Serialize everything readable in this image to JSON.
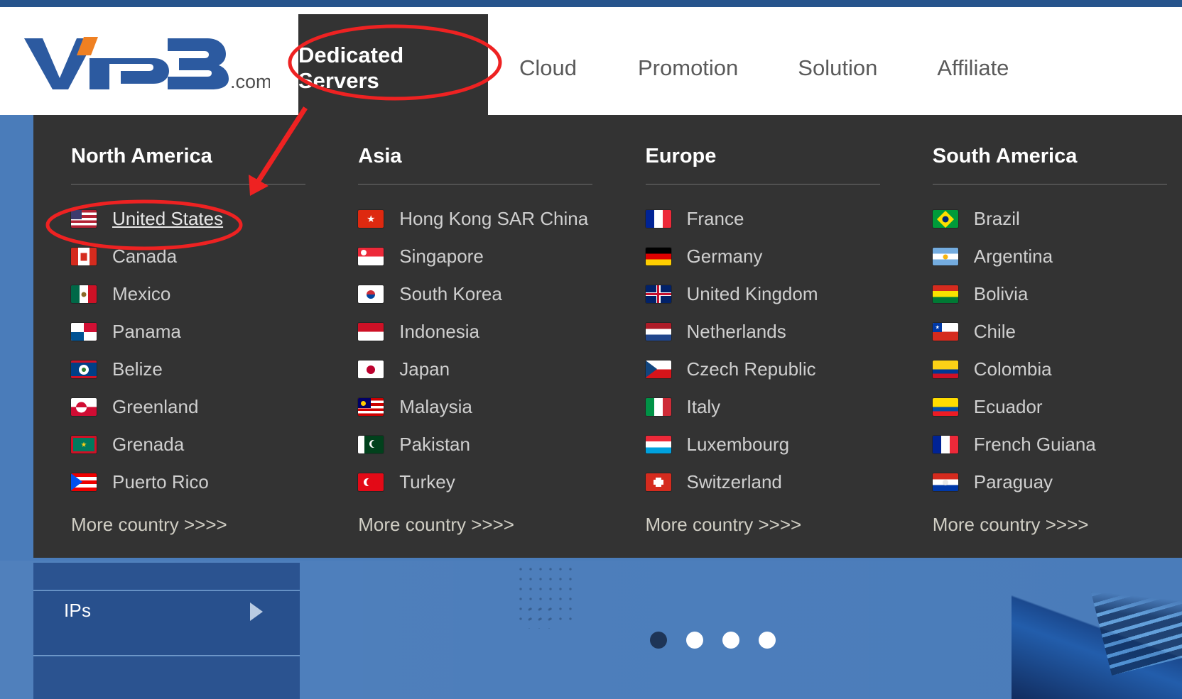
{
  "brand": {
    "logo_text": "VPB",
    "logo_suffix": ".com",
    "accent_blue": "#2c5aa0",
    "accent_orange": "#ef8022"
  },
  "nav": {
    "items": [
      {
        "label": "Dedicated Servers",
        "active": true
      },
      {
        "label": "Cloud",
        "active": false
      },
      {
        "label": "Promotion",
        "active": false
      },
      {
        "label": "Solution",
        "active": false
      },
      {
        "label": "Affiliate",
        "active": false
      }
    ]
  },
  "mega_menu": {
    "more_link_label": "More country >>>>",
    "columns": [
      {
        "title": "North America",
        "countries": [
          {
            "name": "United States",
            "flag": "us",
            "highlighted": true
          },
          {
            "name": "Canada",
            "flag": "ca",
            "highlighted": false
          },
          {
            "name": "Mexico",
            "flag": "mx",
            "highlighted": false
          },
          {
            "name": "Panama",
            "flag": "pa",
            "highlighted": false
          },
          {
            "name": "Belize",
            "flag": "bz",
            "highlighted": false
          },
          {
            "name": "Greenland",
            "flag": "gl",
            "highlighted": false
          },
          {
            "name": "Grenada",
            "flag": "gd",
            "highlighted": false
          },
          {
            "name": "Puerto Rico",
            "flag": "pr",
            "highlighted": false
          }
        ]
      },
      {
        "title": "Asia",
        "countries": [
          {
            "name": "Hong Kong SAR China",
            "flag": "hk",
            "highlighted": false
          },
          {
            "name": "Singapore",
            "flag": "sg",
            "highlighted": false
          },
          {
            "name": "South Korea",
            "flag": "kr",
            "highlighted": false
          },
          {
            "name": "Indonesia",
            "flag": "id",
            "highlighted": false
          },
          {
            "name": "Japan",
            "flag": "jp",
            "highlighted": false
          },
          {
            "name": "Malaysia",
            "flag": "my",
            "highlighted": false
          },
          {
            "name": "Pakistan",
            "flag": "pk",
            "highlighted": false
          },
          {
            "name": "Turkey",
            "flag": "tr",
            "highlighted": false
          }
        ]
      },
      {
        "title": "Europe",
        "countries": [
          {
            "name": "France",
            "flag": "fr",
            "highlighted": false
          },
          {
            "name": "Germany",
            "flag": "de",
            "highlighted": false
          },
          {
            "name": "United Kingdom",
            "flag": "gb",
            "highlighted": false
          },
          {
            "name": "Netherlands",
            "flag": "nl",
            "highlighted": false
          },
          {
            "name": "Czech Republic",
            "flag": "cz",
            "highlighted": false
          },
          {
            "name": "Italy",
            "flag": "it",
            "highlighted": false
          },
          {
            "name": "Luxembourg",
            "flag": "lu",
            "highlighted": false
          },
          {
            "name": "Switzerland",
            "flag": "ch",
            "highlighted": false
          }
        ]
      },
      {
        "title": "South America",
        "countries": [
          {
            "name": "Brazil",
            "flag": "br",
            "highlighted": false
          },
          {
            "name": "Argentina",
            "flag": "ar",
            "highlighted": false
          },
          {
            "name": "Bolivia",
            "flag": "bo",
            "highlighted": false
          },
          {
            "name": "Chile",
            "flag": "cl",
            "highlighted": false
          },
          {
            "name": "Colombia",
            "flag": "co",
            "highlighted": false
          },
          {
            "name": "Ecuador",
            "flag": "ec",
            "highlighted": false
          },
          {
            "name": "French Guiana",
            "flag": "gf",
            "highlighted": false
          },
          {
            "name": "Paraguay",
            "flag": "py",
            "highlighted": false
          }
        ]
      }
    ]
  },
  "sidebar": {
    "ips_label": "IPs"
  },
  "carousel": {
    "total_dots": 4,
    "active_index": 0
  },
  "annotations": {
    "color": "#ee2222",
    "ellipse_nav_target": "Dedicated Servers",
    "ellipse_country_target": "United States",
    "arrow_from": "Dedicated Servers",
    "arrow_to": "United States"
  }
}
